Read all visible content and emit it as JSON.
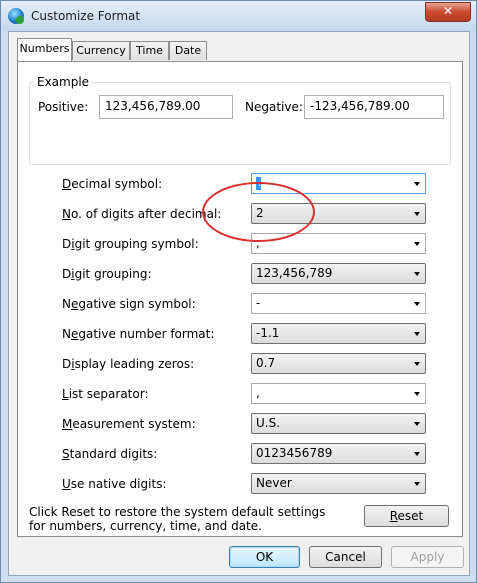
{
  "window": {
    "title": "Customize Format",
    "close_glyph": "✕"
  },
  "tabs": [
    {
      "label": "Numbers",
      "active": true
    },
    {
      "label": "Currency",
      "active": false
    },
    {
      "label": "Time",
      "active": false
    },
    {
      "label": "Date",
      "active": false
    }
  ],
  "example": {
    "group_label": "Example",
    "positive_label": "Positive:",
    "positive_value": "123,456,789.00",
    "negative_label": "Negative:",
    "negative_value": "-123,456,789.00"
  },
  "settings": [
    {
      "label": "Decimal symbol:",
      "value": ".",
      "kind": "editable"
    },
    {
      "label": "No. of digits after decimal:",
      "value": "2",
      "kind": "dropdown"
    },
    {
      "label": "Digit grouping symbol:",
      "value": ",",
      "kind": "editable"
    },
    {
      "label": "Digit grouping:",
      "value": "123,456,789",
      "kind": "dropdown"
    },
    {
      "label": "Negative sign symbol:",
      "value": "-",
      "kind": "editable"
    },
    {
      "label": "Negative number format:",
      "value": "-1.1",
      "kind": "dropdown"
    },
    {
      "label": "Display leading zeros:",
      "value": "0.7",
      "kind": "dropdown"
    },
    {
      "label": "List separator:",
      "value": ",",
      "kind": "editable"
    },
    {
      "label": "Measurement system:",
      "value": "U.S.",
      "kind": "dropdown"
    },
    {
      "label": "Standard digits:",
      "value": "0123456789",
      "kind": "dropdown"
    },
    {
      "label": "Use native digits:",
      "value": "Never",
      "kind": "dropdown"
    }
  ],
  "reset": {
    "info_text": "Click Reset to restore the system default settings for numbers, currency, time, and date.",
    "button_label": "Reset"
  },
  "footer": {
    "ok_label": "OK",
    "cancel_label": "Cancel",
    "apply_label": "Apply"
  },
  "annotation": {
    "color": "#d83030"
  }
}
